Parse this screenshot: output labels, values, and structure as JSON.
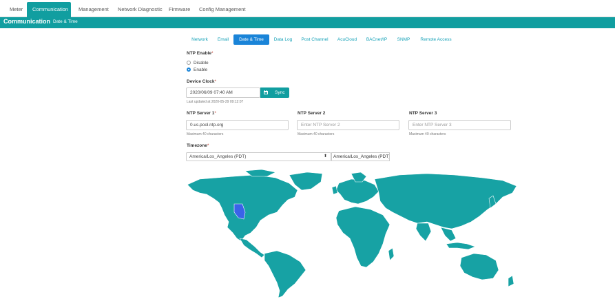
{
  "topnav": {
    "tabs": [
      {
        "label": "Meter",
        "active": false
      },
      {
        "label": "Communication",
        "active": true
      },
      {
        "label": "Management",
        "active": false
      },
      {
        "label": "Network Diagnostic",
        "active": false
      },
      {
        "label": "Firmware",
        "active": false
      },
      {
        "label": "Config Management",
        "active": false
      }
    ]
  },
  "banner": {
    "title": "Communication",
    "subtitle": "Date & Time"
  },
  "subtabs": [
    {
      "label": "Network",
      "active": false
    },
    {
      "label": "Email",
      "active": false
    },
    {
      "label": "Date & Time",
      "active": true
    },
    {
      "label": "Data Log",
      "active": false
    },
    {
      "label": "Post Channel",
      "active": false
    },
    {
      "label": "AcuCloud",
      "active": false
    },
    {
      "label": "BACnet/IP",
      "active": false
    },
    {
      "label": "SNMP",
      "active": false
    },
    {
      "label": "Remote Access",
      "active": false
    }
  ],
  "ntp_enable": {
    "label": "NTP Enable",
    "options": [
      {
        "label": "Disable",
        "checked": false
      },
      {
        "label": "Enable",
        "checked": true
      }
    ]
  },
  "device_clock": {
    "label": "Device Clock",
    "value": "2020/06/09 07:40 AM",
    "sync_label": "Sync",
    "last_updated": "Last updated at 2020-05-29 09:12:07"
  },
  "ntp_servers": [
    {
      "label": "NTP Server 1",
      "required": true,
      "value": "0.us.pool.ntp.org",
      "placeholder": "",
      "hint": "Maximum 40 characters"
    },
    {
      "label": "NTP Server 2",
      "required": false,
      "value": "",
      "placeholder": "Enter NTP Server 2",
      "hint": "Maximum 40 characters"
    },
    {
      "label": "NTP Server 3",
      "required": false,
      "value": "",
      "placeholder": "Enter NTP Server 3",
      "hint": "Maximum 40 characters"
    }
  ],
  "timezone": {
    "label": "Timezone",
    "selected": "America/Los_Angeles (PDT)",
    "display": "America/Los_Angeles (PDT)"
  },
  "colors": {
    "accent": "#119ea0",
    "active_tab": "#1a84d8",
    "map_land": "#17a2a4",
    "map_selected": "#3a63e8"
  }
}
